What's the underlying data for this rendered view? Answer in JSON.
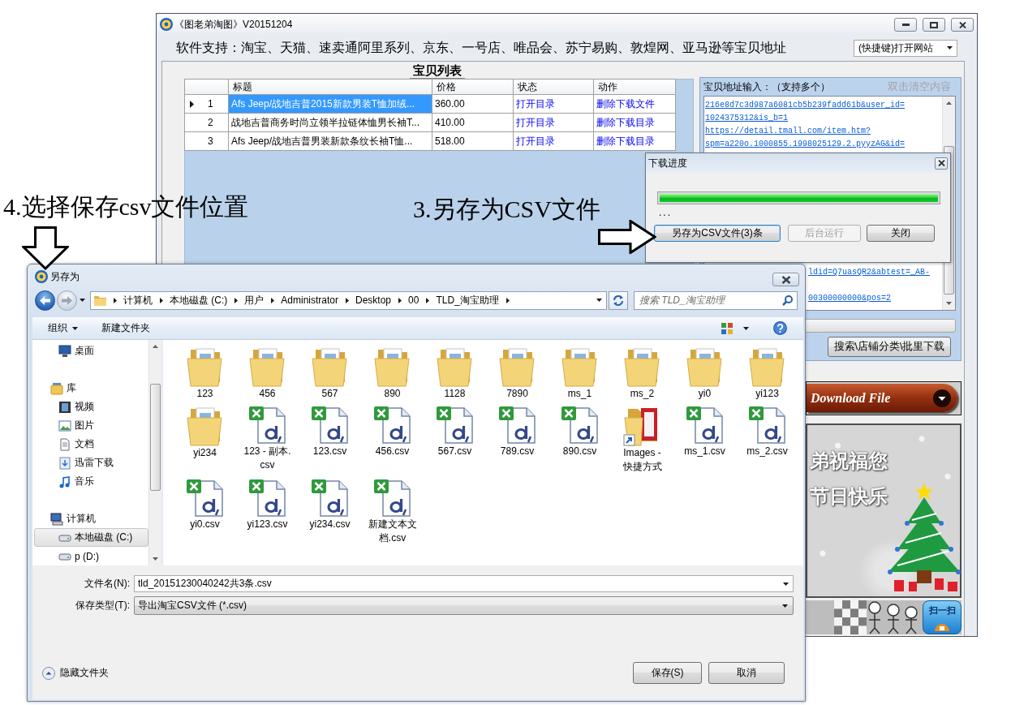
{
  "main_window": {
    "title": "《图老弟淘图》V20151204",
    "support_text": "软件支持：淘宝、天猫、速卖通阿里系列、京东、一号店、唯品会、苏宁易购、敦煌网、亚马逊等宝贝地址",
    "site_dropdown": {
      "value": "(快捷键)打开网站"
    },
    "product_list": {
      "title": "宝贝列表",
      "columns": [
        "标题",
        "价格",
        "状态",
        "动作"
      ],
      "rows": [
        {
          "number": "1",
          "selected": true,
          "title": "Afs Jeep/战地吉普2015新款男装T恤加绒...",
          "price": "360.00",
          "status": "打开目录",
          "action": "删除下载文件"
        },
        {
          "number": "2",
          "selected": false,
          "title": "战地吉普商务时尚立领半拉链体恤男长袖T...",
          "price": "410.00",
          "status": "打开目录",
          "action": "删除下载目录"
        },
        {
          "number": "3",
          "selected": false,
          "title": "Afs Jeep/战地吉普男装新款条纹长袖T恤...",
          "price": "518.00",
          "status": "打开目录",
          "action": "删除下载目录"
        }
      ]
    },
    "address_input": {
      "label": "宝贝地址输入：（支持多个）",
      "hint": "双击清空内容",
      "lines": [
        {
          "text": "216e8d7c3d987a6081cb5b239fadd61b&user_id=",
          "kind": "full"
        },
        {
          "text": "1024375312&is_b=1",
          "kind": "full"
        },
        {
          "text": "https://detail.tmall.com/item.htm?",
          "kind": "full"
        },
        {
          "text": "spm=a220o.1000855.1998025129.2.pyyzAG&id=",
          "kind": "full"
        },
        {
          "text": "ldid=Q7uasQR2&abtest=_AB-",
          "kind": "clipped"
        },
        {
          "text": "00300000000&pos=2",
          "kind": "clipped"
        }
      ]
    },
    "batch_button": {
      "label": "搜索\\店铺分类\\批里下载"
    },
    "download_banner": {
      "label": "Download File"
    },
    "holiday_banner": {
      "lines": [
        "弟祝福您",
        "节日快乐"
      ]
    },
    "scan_button": {
      "label": "扫一扫"
    }
  },
  "download_dialog": {
    "title": "下载进度",
    "progress": {
      "level": 1
    },
    "status": "...",
    "buttons": [
      {
        "label": "另存为CSV文件(3)条",
        "focused": true,
        "disabled": false
      },
      {
        "label": "后台运行",
        "focused": false,
        "disabled": true
      },
      {
        "label": "关闭",
        "focused": false,
        "disabled": false
      }
    ]
  },
  "save_dialog": {
    "title": "另存为",
    "breadcrumb": [
      "计算机",
      "本地磁盘 (C:)",
      "用户",
      "Administrator",
      "Desktop",
      "00",
      "TLD_淘宝助理"
    ],
    "search": {
      "placeholder": "搜索 TLD_淘宝助理"
    },
    "toolbar": [
      {
        "label": "组织",
        "kind": "menu"
      },
      {
        "label": "新建文件夹",
        "kind": "button"
      }
    ],
    "nav": [
      {
        "children": [
          {
            "label": "桌面",
            "kind": "desktop",
            "selected": false
          }
        ]
      },
      {
        "label": "库",
        "kind": "library",
        "selected": false,
        "children": [
          {
            "label": "视频",
            "kind": "video",
            "selected": false
          },
          {
            "label": "图片",
            "kind": "picture",
            "selected": false
          },
          {
            "label": "文档",
            "kind": "document",
            "selected": false
          },
          {
            "label": "迅雷下载",
            "kind": "download",
            "selected": false
          },
          {
            "label": "音乐",
            "kind": "music",
            "selected": false
          }
        ]
      },
      {
        "label": "计算机",
        "kind": "computer",
        "selected": false,
        "children": [
          {
            "label": "本地磁盘 (C:)",
            "kind": "drive",
            "selected": true
          },
          {
            "label": "p (D:)",
            "kind": "drive",
            "selected": false
          }
        ]
      }
    ],
    "files": [
      {
        "name": "123",
        "kind": "folder"
      },
      {
        "name": "456",
        "kind": "folder"
      },
      {
        "name": "567",
        "kind": "folder"
      },
      {
        "name": "890",
        "kind": "folder"
      },
      {
        "name": "1128",
        "kind": "folder"
      },
      {
        "name": "7890",
        "kind": "folder"
      },
      {
        "name": "ms_1",
        "kind": "folder"
      },
      {
        "name": "ms_2",
        "kind": "folder"
      },
      {
        "name": "yi0",
        "kind": "folder"
      },
      {
        "name": "yi123",
        "kind": "folder"
      },
      {
        "name": "yi234",
        "kind": "folder"
      },
      {
        "name": "123 - 副本.csv",
        "kind": "csv"
      },
      {
        "name": "123.csv",
        "kind": "csv"
      },
      {
        "name": "456.csv",
        "kind": "csv"
      },
      {
        "name": "567.csv",
        "kind": "csv"
      },
      {
        "name": "789.csv",
        "kind": "csv"
      },
      {
        "name": "890.csv",
        "kind": "csv"
      },
      {
        "name": "Images - 快捷方式",
        "kind": "shortcut"
      },
      {
        "name": "ms_1.csv",
        "kind": "csv"
      },
      {
        "name": "ms_2.csv",
        "kind": "csv"
      },
      {
        "name": "yi0.csv",
        "kind": "csv"
      },
      {
        "name": "yi123.csv",
        "kind": "csv"
      },
      {
        "name": "yi234.csv",
        "kind": "csv"
      },
      {
        "name": "新建文本文档.csv",
        "kind": "csv"
      }
    ],
    "file_name": {
      "label": "文件名(N):",
      "value": "tld_20151230040242共3条.csv"
    },
    "file_type": {
      "label": "保存类型(T):",
      "value": "导出淘宝CSV文件 (*.csv)"
    },
    "hide_folders": {
      "label": "隐藏文件夹"
    },
    "buttons": [
      {
        "label": "保存(S)"
      },
      {
        "label": "取消"
      }
    ]
  },
  "annotations": [
    {
      "text": "4.选择保存csv文件位置",
      "kind": "down"
    },
    {
      "text": "3.另存为CSV文件",
      "kind": "right"
    }
  ]
}
